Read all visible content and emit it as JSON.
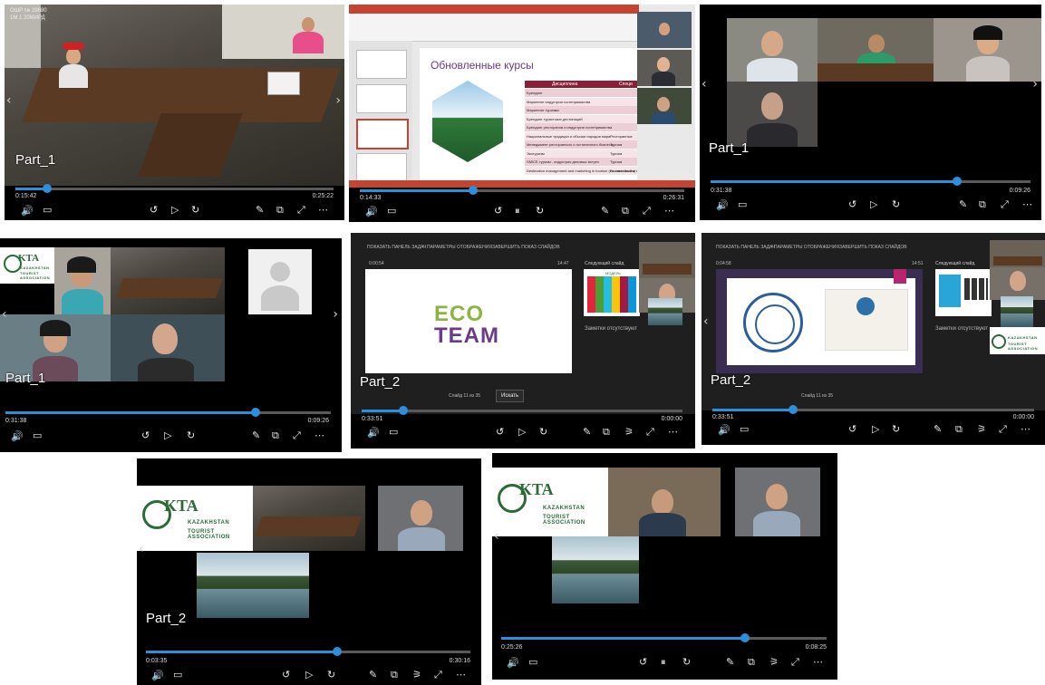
{
  "players": [
    {
      "id": "p1",
      "caption": "Part_1",
      "elapsed": "0:15:42",
      "remaining": "0:25:22",
      "progress": 0.1,
      "play_state": "play",
      "room_label_1": "ОШР № 29680",
      "room_label_2": "1М  1 20МИРД"
    },
    {
      "id": "p2",
      "caption": "",
      "elapsed": "0:14:33",
      "remaining": "0:26:31",
      "progress": 0.35,
      "play_state": "pause",
      "slide": {
        "title": "Обновленные курсы",
        "table_header": "Дисциплина",
        "table_header2": "Специ",
        "rows": [
          "Брендинг",
          "Маркетинг индустрии гостеприимства",
          "Маркетинг туризма",
          "Брендинг туристских дестинаций",
          "Брендинг ресторанов и индустрии гостеприимства",
          "Национальные традиции и обычаи народов мира",
          "Менеджмент ресторанного и гостиничного бизнеса",
          "Экотуризм",
          "SMICE туризм - индустрия деловых встреч",
          "Destination management and marketing in tourism (на английском)"
        ],
        "right_col": [
          "Ресторанные",
          "Туризм",
          "Туризм",
          "Туризм",
          "Гостиничный и туризм"
        ]
      }
    },
    {
      "id": "p3",
      "caption": "Part_1",
      "elapsed": "0:31:38",
      "remaining": "0:09:26",
      "progress": 0.77,
      "play_state": "play"
    },
    {
      "id": "p4",
      "caption": "Part_1",
      "elapsed": "0:31:38",
      "remaining": "0:09:26",
      "progress": 0.77,
      "play_state": "play",
      "kta": {
        "logo": "KTA",
        "line1": "KAZAKHSTAN",
        "line2": "TOURIST ASSOCIATION"
      }
    },
    {
      "id": "p5",
      "caption": "Part_2",
      "elapsed": "0:33:51",
      "remaining": "0:00:00",
      "progress": 0.13,
      "play_state": "play",
      "presenter": {
        "toolbar": [
          "ПОКАЗАТЬ ПАНЕЛЬ ЗАДАЧ",
          "ПАРАМЕТРЫ ОТОБРАЖЕНИЯ",
          "ЗАВЕРШИТЬ ПОКАЗ СЛАЙДОВ"
        ],
        "timer": "0:00:54",
        "clock": "14:47",
        "eco1": "ECO",
        "eco2": "TEAM",
        "next_label": "Следующий слайд",
        "notes": "Заметки отсутствуют",
        "slide_counter": "Слайд 11 из 35",
        "tooltip": "Искать",
        "next_slide_heading": "МОДЕЛЬ"
      }
    },
    {
      "id": "p6",
      "caption": "Part_2",
      "elapsed": "0:33:51",
      "remaining": "0:00:00",
      "progress": 0.25,
      "play_state": "play",
      "presenter": {
        "toolbar": [
          "ПОКАЗАТЬ ПАНЕЛЬ ЗАДАЧ",
          "ПАРАМЕТРЫ ОТОБРАЖЕНИЯ",
          "ЗАВЕРШИТЬ ПОКАЗ СЛАЙДОВ"
        ],
        "timer": "0:04:58",
        "clock": "14:51",
        "next_label": "Следующий слайд",
        "notes": "Заметки отсутствуют",
        "slide_counter": "Слайд 11 из 35",
        "kta": {
          "line1": "KAZAKHSTAN",
          "line2": "TOURIST ASSOCIATION"
        }
      }
    },
    {
      "id": "p7",
      "caption": "Part_2",
      "elapsed": "0:03:35",
      "remaining": "0:30:16",
      "progress": 0.59,
      "play_state": "play",
      "kta": {
        "logo": "KTA",
        "line1": "KAZAKHSTAN",
        "line2": "TOURIST ASSOCIATION"
      }
    },
    {
      "id": "p8",
      "caption": "",
      "elapsed": "0:25:26",
      "remaining": "0:08:25",
      "progress": 0.75,
      "play_state": "pause",
      "kta": {
        "logo": "KTA",
        "line1": "KAZAKHSTAN",
        "line2": "TOURIST ASSOCIATION"
      }
    }
  ],
  "controls": {
    "volume": "🔊",
    "subtitles": "▭",
    "rewind": "↺",
    "play": "▷",
    "pause": "⏸",
    "forward": "↻",
    "pen": "✎",
    "miniview": "⧉",
    "fullscreen": "⤢",
    "more": "⋯",
    "cast": "⚞",
    "prev": "‹",
    "next": "›"
  },
  "colors": {
    "accent": "#2d8fd9",
    "background": "#000000",
    "ppt_ribbon": "#c6432f",
    "kta_green": "#2a6b36"
  }
}
